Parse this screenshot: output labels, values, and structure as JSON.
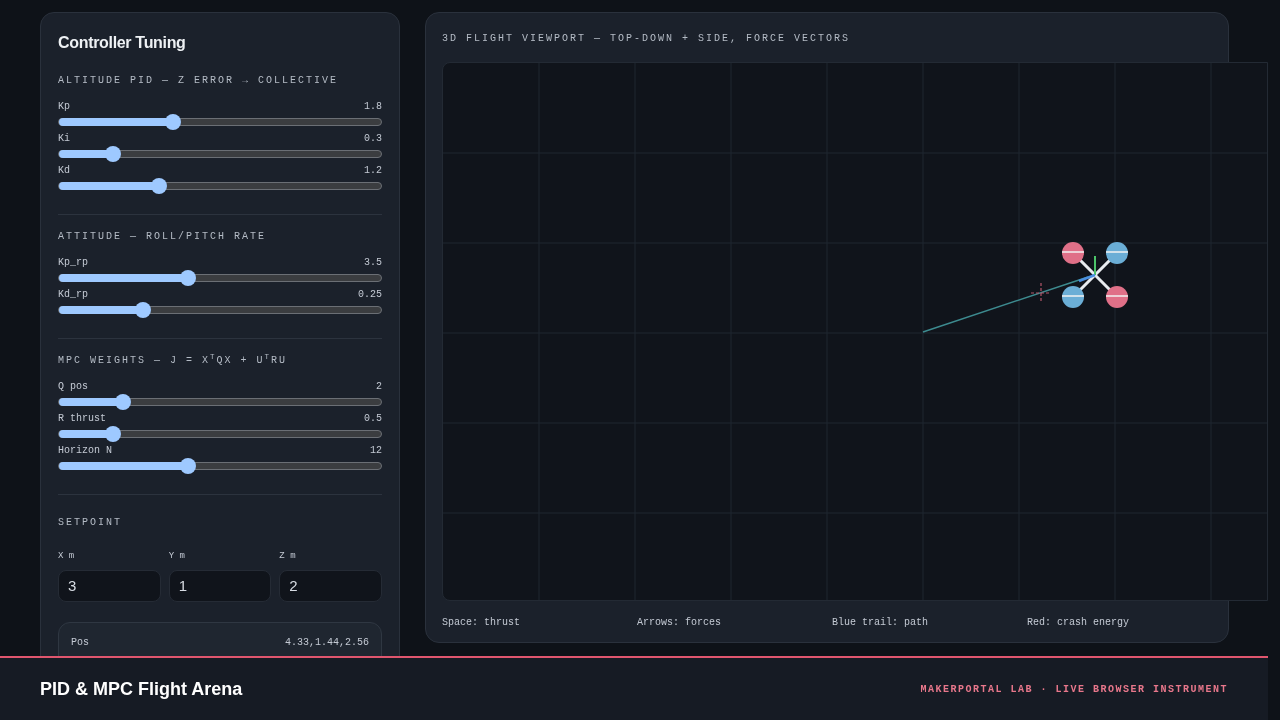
{
  "panel": {
    "title": "Controller Tuning",
    "sections": [
      {
        "kind": "sliders",
        "heading": "ALTITUDE PID — Z ERROR → COLLECTIVE",
        "sliders": [
          {
            "label": "Kp",
            "reading": "1.8",
            "level": 0.355
          },
          {
            "label": "Ki",
            "reading": "0.3",
            "level": 0.167
          },
          {
            "label": "Kd",
            "reading": "1.2",
            "level": 0.31
          }
        ]
      },
      {
        "kind": "sliders",
        "heading": "ATTITUDE — ROLL/PITCH RATE",
        "sliders": [
          {
            "label": "Kp_rp",
            "reading": "3.5",
            "level": 0.4
          },
          {
            "label": "Kd_rp",
            "reading": "0.25",
            "level": 0.26
          }
        ]
      },
      {
        "kind": "sliders",
        "heading": "MPC WEIGHTS — J = X$^{T}$QX + U$^{T}$RU",
        "sliders": [
          {
            "label": "Q pos",
            "reading": "2",
            "level": 0.2
          },
          {
            "label": "R thrust",
            "reading": "0.5",
            "level": 0.167
          },
          {
            "label": "Horizon N",
            "reading": "12",
            "level": 0.4
          }
        ]
      },
      {
        "kind": "setpoint",
        "heading": "SETPOINT",
        "fields": [
          {
            "label": "X m",
            "value": "3"
          },
          {
            "label": "Y m",
            "value": "1"
          },
          {
            "label": "Z m",
            "value": "2"
          }
        ]
      }
    ],
    "stats": [
      {
        "label": "Pos",
        "value": "4.33,1.44,2.56"
      }
    ]
  },
  "viewport": {
    "title": "3D FLIGHT VIEWPORT — TOP-DOWN + SIDE, FORCE VECTORS",
    "legend": [
      "Space: thrust",
      "Arrows: forces",
      "Blue trail: path",
      "Red: crash energy"
    ]
  },
  "footer": {
    "title": "PID & MPC Flight Arena",
    "tagline": "MAKERPORTAL LAB · LIVE BROWSER INSTRUMENT"
  }
}
